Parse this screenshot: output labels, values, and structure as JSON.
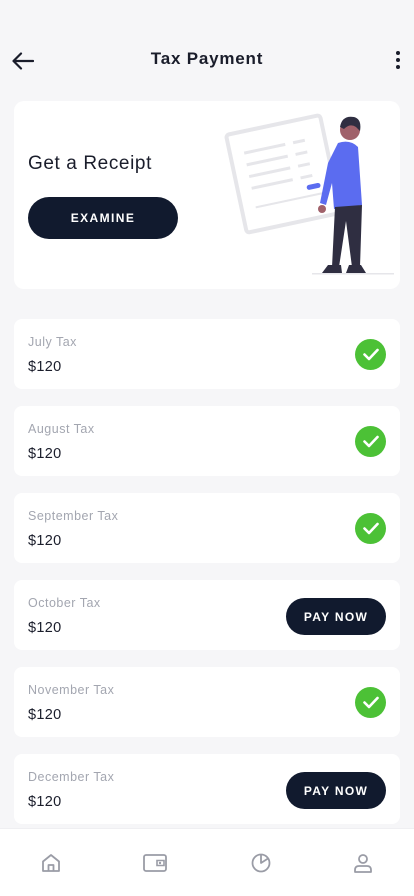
{
  "header": {
    "title": "Tax Payment",
    "back_icon": "arrow-left-icon",
    "menu_icon": "more-vertical-icon"
  },
  "receipt_card": {
    "title": "Get a Receipt",
    "button_label": "EXAMINE"
  },
  "taxes": [
    {
      "label": "July Tax",
      "amount": "$120",
      "status": "paid"
    },
    {
      "label": "August Tax",
      "amount": "$120",
      "status": "paid"
    },
    {
      "label": "September Tax",
      "amount": "$120",
      "status": "paid"
    },
    {
      "label": "October Tax",
      "amount": "$120",
      "status": "unpaid",
      "action": "PAY NOW"
    },
    {
      "label": "November Tax",
      "amount": "$120",
      "status": "paid"
    },
    {
      "label": "December Tax",
      "amount": "$120",
      "status": "unpaid",
      "action": "PAY NOW"
    }
  ],
  "bottom_nav": {
    "items": [
      "home-icon",
      "wallet-icon",
      "pie-chart-icon",
      "user-icon"
    ]
  },
  "colors": {
    "background": "#f6f6f8",
    "card": "#ffffff",
    "primary_dark": "#111a2e",
    "success": "#4cc136",
    "muted_text": "#a3a6b0",
    "accent": "#5b6cf0"
  }
}
